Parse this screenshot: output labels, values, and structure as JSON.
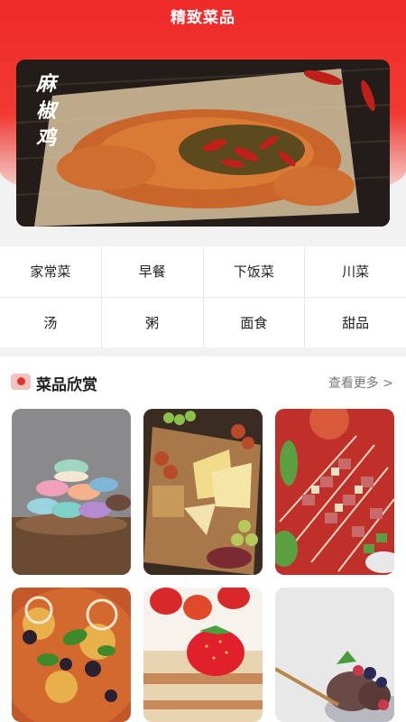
{
  "header": {
    "title": "精致菜品"
  },
  "banner": {
    "caption": "麻椒鸡"
  },
  "categories": [
    {
      "label": "家常菜"
    },
    {
      "label": "早餐"
    },
    {
      "label": "下饭菜"
    },
    {
      "label": "川菜"
    },
    {
      "label": "汤"
    },
    {
      "label": "粥"
    },
    {
      "label": "面食"
    },
    {
      "label": "甜品"
    }
  ],
  "section": {
    "title": "菜品欣赏",
    "more": "查看更多 >"
  },
  "cards": [
    {
      "icon": "macarons-photo"
    },
    {
      "icon": "cheese-board-photo"
    },
    {
      "icon": "meat-skewers-photo"
    },
    {
      "icon": "pizza-photo"
    },
    {
      "icon": "strawberry-cake-photo"
    },
    {
      "icon": "ice-cream-photo"
    }
  ],
  "colors": {
    "brand": "#ef2a2a",
    "text": "#222222",
    "muted": "#777777"
  }
}
